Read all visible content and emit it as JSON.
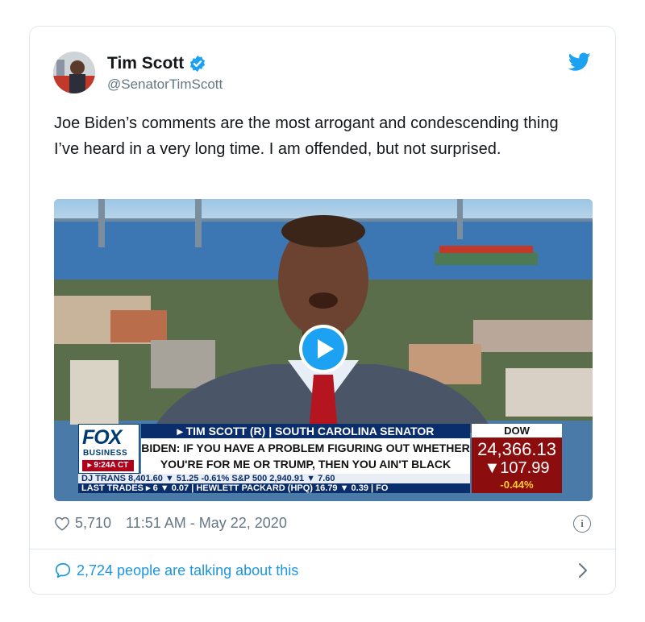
{
  "tweet": {
    "author_name": "Tim Scott",
    "handle": "@SenatorTimScott",
    "text": "Joe Biden’s comments are the most arrogant and condescending thing I’ve heard in a very long time. I am offended, but not surprised.",
    "likes": "5,710",
    "timestamp": "11:51 AM - May 22, 2020",
    "talking": "2,724 people are talking about this"
  },
  "video": {
    "network": "FOX",
    "network_sub": "BUSINESS",
    "local_time": "▸ 9:24A CT",
    "name_strap": "▸ TIM SCOTT (R) | SOUTH CAROLINA SENATOR",
    "headline_line1": "BIDEN: IF YOU HAVE A PROBLEM FIGURING OUT WHETHER",
    "headline_line2": "YOU'RE FOR ME OR TRUMP, THEN YOU AIN'T BLACK",
    "ticker_top": "DJ TRANS  8,401.60 ▼ 51.25  -0.61%  S&P 500  2,940.91 ▼ 7.60",
    "ticker_bottom": "LAST TRADES ▸ 6 ▼ 0.07 | HEWLETT PACKARD (HPQ) 16.79 ▼ 0.39 | FO",
    "dow_label": "DOW",
    "dow_value": "24,366.13",
    "dow_change": "▼107.99",
    "dow_percent": "-0.44%"
  },
  "colors": {
    "twitter_blue": "#1da1f2",
    "link_blue": "#1b95e0",
    "muted_gray": "#657786",
    "fox_navy": "#0a2d6b",
    "dow_red": "#8b0d0d"
  },
  "icons": [
    "verified-badge-icon",
    "twitter-bird-icon",
    "play-icon",
    "heart-icon",
    "info-icon",
    "speech-bubble-icon",
    "chevron-right-icon"
  ]
}
